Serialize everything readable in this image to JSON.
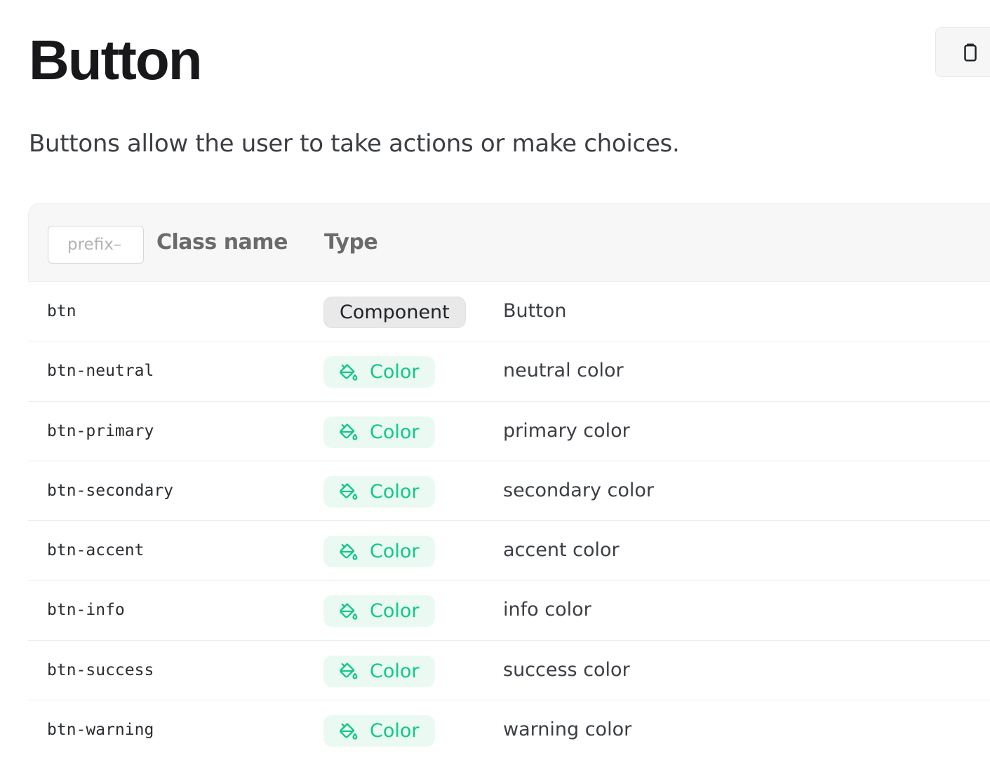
{
  "page": {
    "title": "Button",
    "description": "Buttons allow the user to take actions or make choices."
  },
  "copy_button": {
    "icon": "clipboard-icon"
  },
  "table": {
    "prefix_placeholder": "prefix–",
    "headers": {
      "class_name": "Class name",
      "type": "Type"
    },
    "rows": [
      {
        "class": "btn",
        "type": "Component",
        "type_icon": "",
        "description": "Button"
      },
      {
        "class": "btn-neutral",
        "type": "Color",
        "type_icon": "paint-bucket-icon",
        "description": "neutral color"
      },
      {
        "class": "btn-primary",
        "type": "Color",
        "type_icon": "paint-bucket-icon",
        "description": "primary color"
      },
      {
        "class": "btn-secondary",
        "type": "Color",
        "type_icon": "paint-bucket-icon",
        "description": "secondary color"
      },
      {
        "class": "btn-accent",
        "type": "Color",
        "type_icon": "paint-bucket-icon",
        "description": "accent color"
      },
      {
        "class": "btn-info",
        "type": "Color",
        "type_icon": "paint-bucket-icon",
        "description": "info color"
      },
      {
        "class": "btn-success",
        "type": "Color",
        "type_icon": "paint-bucket-icon",
        "description": "success color"
      },
      {
        "class": "btn-warning",
        "type": "Color",
        "type_icon": "paint-bucket-icon",
        "description": "warning color"
      }
    ]
  },
  "colors": {
    "color_badge_text": "#12c78a",
    "color_badge_bg": "#eafaf3",
    "component_badge_bg": "#e9e9e9",
    "header_bg": "#f7f7f7"
  }
}
